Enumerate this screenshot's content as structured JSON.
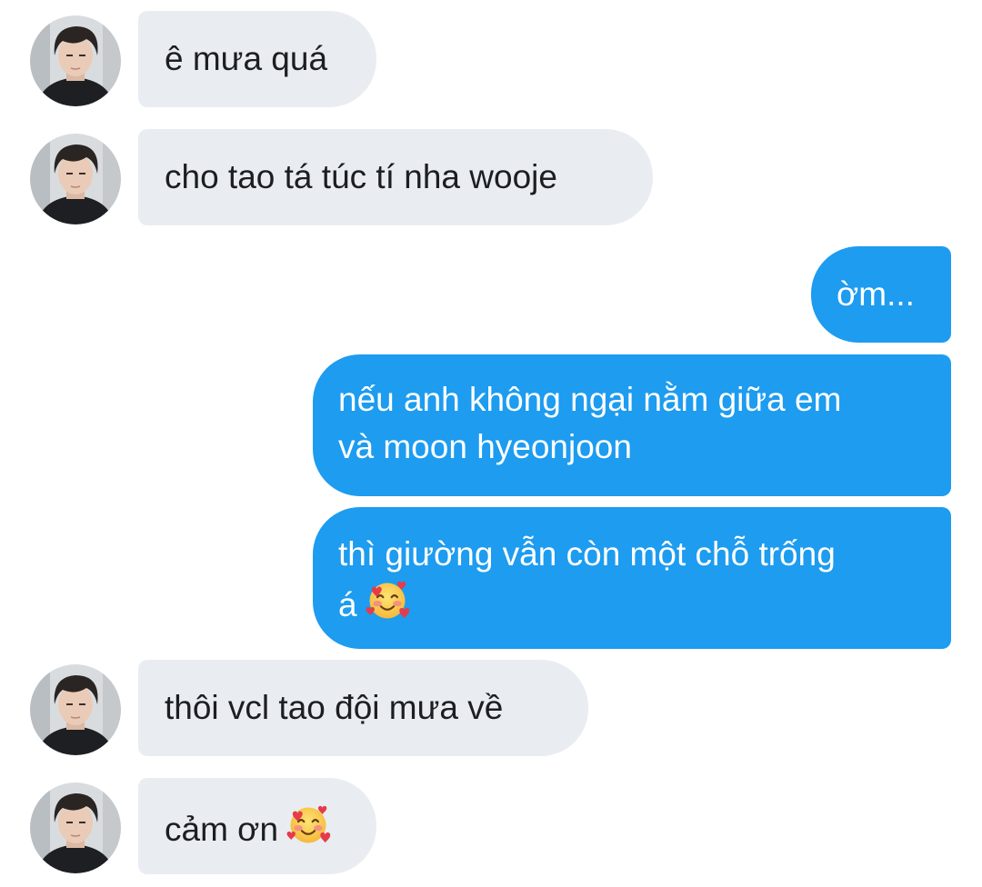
{
  "messages": [
    {
      "direction": "incoming",
      "text": "ê mưa quá"
    },
    {
      "direction": "incoming",
      "text": "cho tao tá túc tí nha wooje"
    },
    {
      "direction": "outgoing",
      "text": "ờm..."
    },
    {
      "direction": "outgoing",
      "lines": [
        "nếu anh không ngại nằm giữa em",
        "và moon hyeonjoon"
      ]
    },
    {
      "direction": "outgoing",
      "lines": [
        "thì giường vẫn còn một chỗ trống",
        "á"
      ],
      "emoji": "smiling-face-with-hearts"
    },
    {
      "direction": "incoming",
      "text": "thôi vcl tao đội mưa về"
    },
    {
      "direction": "incoming",
      "text": "cảm ơn",
      "emoji": "smiling-face-with-hearts"
    }
  ],
  "colors": {
    "incoming_bubble": "#e9edf1",
    "incoming_text": "#1c1e21",
    "outgoing_bubble": "#1d9cf0",
    "outgoing_text": "#ffffff",
    "background": "#ffffff"
  },
  "icons": {
    "avatar": "contact-avatar-photo",
    "emoji": "smiling-face-with-hearts"
  }
}
